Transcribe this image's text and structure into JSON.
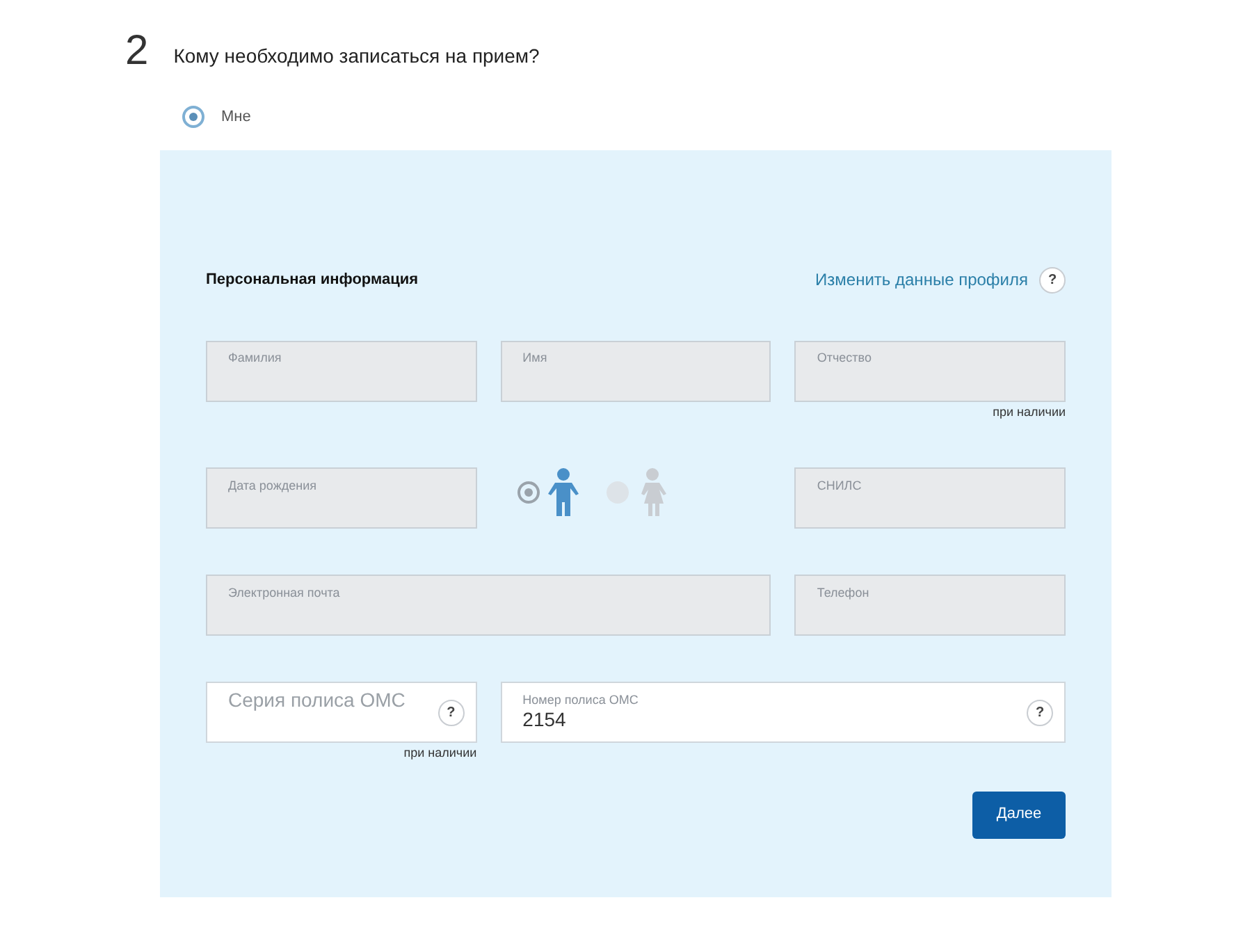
{
  "step": {
    "number": "2",
    "title": "Кому необходимо записаться на прием?"
  },
  "recipient": {
    "options": [
      {
        "label": "Мне",
        "selected": true
      }
    ]
  },
  "section": {
    "title": "Персональная информация",
    "edit_link": "Изменить данные профиля",
    "help": "?"
  },
  "rows": [
    {
      "items": [
        {
          "kind": "field",
          "label": "Фамилия",
          "disabled": true
        },
        {
          "kind": "field",
          "label": "Имя",
          "disabled": true
        },
        {
          "kind": "field",
          "label": "Отчество",
          "disabled": true,
          "hint": "при наличии"
        }
      ]
    },
    {
      "items": [
        {
          "kind": "field",
          "label": "Дата рождения",
          "disabled": true
        },
        {
          "kind": "gender",
          "options": [
            {
              "kind": "male",
              "selected": true
            },
            {
              "kind": "female",
              "selected": false
            }
          ]
        },
        {
          "kind": "field",
          "label": "СНИЛС",
          "disabled": true
        }
      ]
    },
    {
      "items": [
        {
          "kind": "field",
          "label": "Электронная почта",
          "disabled": true,
          "wide": true
        },
        {
          "kind": "field",
          "label": "Телефон",
          "disabled": true
        }
      ]
    },
    {
      "items": [
        {
          "kind": "field",
          "placeholder": "Серия полиса ОМС",
          "disabled": false,
          "help": "?",
          "hint": "при наличии"
        },
        {
          "kind": "field",
          "label": "Номер полиса ОМС",
          "value": "2154",
          "disabled": false,
          "wide": true,
          "help": "?"
        }
      ]
    }
  ],
  "submit": {
    "label": "Далее"
  }
}
